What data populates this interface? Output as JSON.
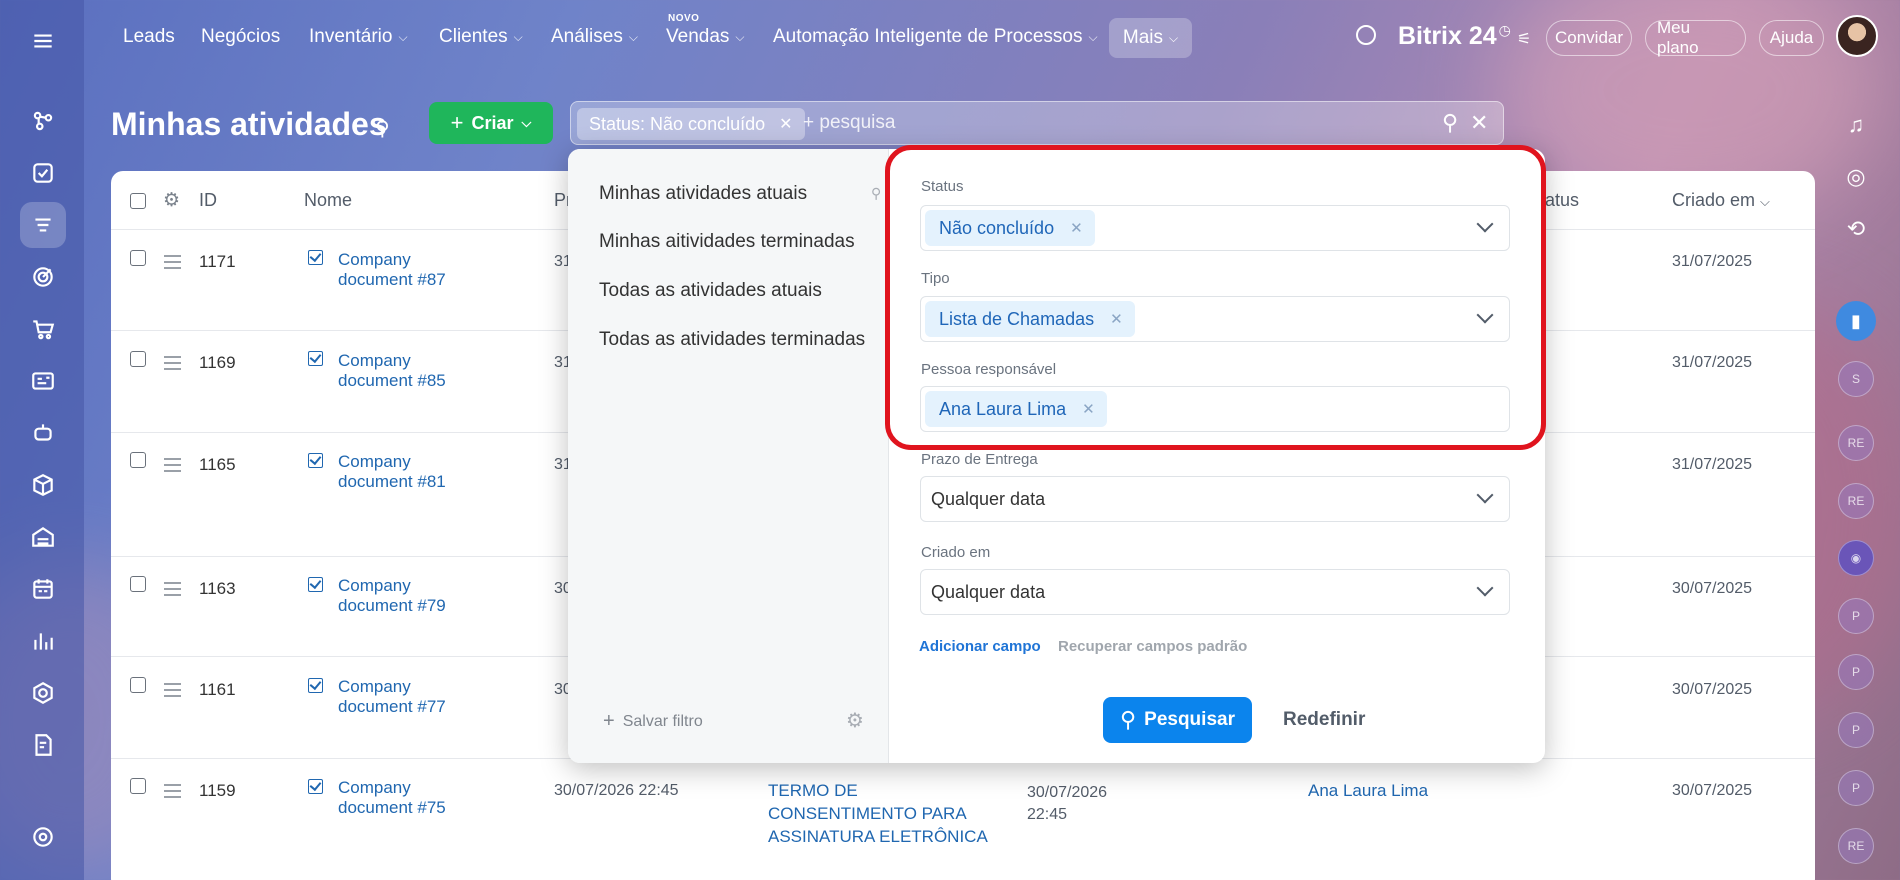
{
  "topnav": {
    "items": [
      {
        "label": "Leads",
        "has_menu": false
      },
      {
        "label": "Negócios",
        "has_menu": false
      },
      {
        "label": "Inventário",
        "has_menu": true
      },
      {
        "label": "Clientes",
        "has_menu": true
      },
      {
        "label": "Análises",
        "has_menu": true
      },
      {
        "label": "Vendas",
        "has_menu": true
      },
      {
        "label": "Automação Inteligente de Processos",
        "has_menu": true
      }
    ],
    "new_badge": "NOVO",
    "more": "Mais",
    "brand": "Bitrix 24",
    "invite": "Convidar",
    "my_plan": "Meu plano",
    "help": "Ajuda"
  },
  "page": {
    "title": "Minhas atividades",
    "create_label": "Criar"
  },
  "filter_bar": {
    "chip": "Status: Não concluído",
    "placeholder": "+ pesquisa"
  },
  "table": {
    "columns": [
      "ID",
      "Nome",
      "Pr",
      "atus",
      "Criado em"
    ],
    "rows": [
      {
        "id": "1171",
        "name_1": "Company",
        "name_2": "document #87",
        "prazo": "31",
        "created": "31/07/2025"
      },
      {
        "id": "1169",
        "name_1": "Company",
        "name_2": "document #85",
        "prazo": "31",
        "created": "31/07/2025"
      },
      {
        "id": "1165",
        "name_1": "Company",
        "name_2": "document #81",
        "prazo": "31",
        "created": "31/07/2025"
      },
      {
        "id": "1163",
        "name_1": "Company",
        "name_2": "document #79",
        "prazo": "30",
        "created": "30/07/2025"
      },
      {
        "id": "1161",
        "name_1": "Company",
        "name_2": "document #77",
        "prazo": "30",
        "created": "30/07/2025"
      },
      {
        "id": "1159",
        "name_1": "Company",
        "name_2": "document #75",
        "prazo": "30/07/2026 22:45",
        "created": "30/07/2025",
        "deal_1": "TERMO DE",
        "deal_2": "CONSENTIMENTO PARA",
        "deal_3": "ASSINATURA ELETRÔNICA",
        "date_1": "30/07/2026",
        "date_2": "22:45",
        "responsible": "Ana Laura Lima"
      }
    ]
  },
  "filter_popup": {
    "presets": [
      "Minhas atividades atuais",
      "Minhas aitividades terminadas",
      "Todas as atividades atuais",
      "Todas as atividades terminadas"
    ],
    "save_filter": "Salvar filtro",
    "fields": {
      "status": {
        "label": "Status",
        "value": "Não concluído"
      },
      "tipo": {
        "label": "Tipo",
        "value": "Lista de Chamadas"
      },
      "responsavel": {
        "label": "Pessoa responsável",
        "value": "Ana Laura Lima"
      },
      "prazo": {
        "label": "Prazo de Entrega",
        "value": "Qualquer data"
      },
      "criado": {
        "label": "Criado em",
        "value": "Qualquer data"
      }
    },
    "add_field": "Adicionar campo",
    "restore_fields": "Recuperar campos padrão",
    "search_button": "Pesquisar",
    "reset_button": "Redefinir"
  },
  "right_rail": {
    "avatars": [
      "S",
      "RE",
      "RE",
      "P",
      "P",
      "P",
      "P",
      "RE"
    ]
  },
  "colors": {
    "create": "#1fb65b",
    "search": "#0b84ed",
    "highlight": "#e0141e",
    "link": "#2067b0"
  }
}
